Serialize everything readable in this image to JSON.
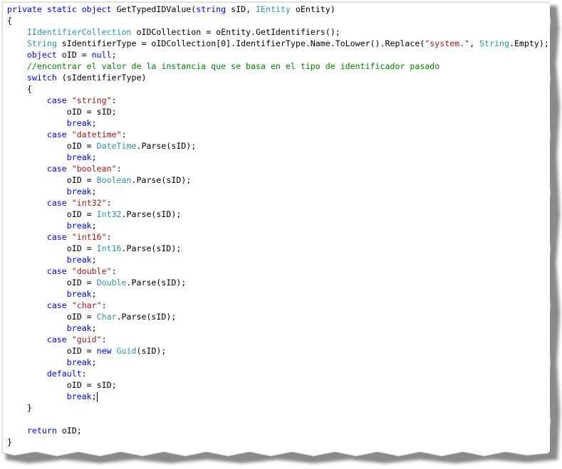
{
  "editor": {
    "lines": [
      [
        {
          "t": "private static object",
          "c": "keyword"
        },
        {
          "t": " GetTypedIDValue(",
          "c": "plain"
        },
        {
          "t": "string",
          "c": "keyword"
        },
        {
          "t": " sID, ",
          "c": "plain"
        },
        {
          "t": "IEntity",
          "c": "type"
        },
        {
          "t": " oEntity)",
          "c": "plain"
        }
      ],
      [
        {
          "t": "{",
          "c": "plain"
        }
      ],
      [
        {
          "t": "    ",
          "c": "plain"
        },
        {
          "t": "IIdentifierCollection",
          "c": "type"
        },
        {
          "t": " oIDCollection = oEntity.GetIdentifiers();",
          "c": "plain"
        }
      ],
      [
        {
          "t": "    ",
          "c": "plain"
        },
        {
          "t": "String",
          "c": "type"
        },
        {
          "t": " sIdentifierType = oIDCollection[0].IdentifierType.Name.ToLower().Replace(",
          "c": "plain"
        },
        {
          "t": "\"system.\"",
          "c": "string"
        },
        {
          "t": ", ",
          "c": "plain"
        },
        {
          "t": "String",
          "c": "type"
        },
        {
          "t": ".Empty);",
          "c": "plain"
        }
      ],
      [
        {
          "t": "    ",
          "c": "plain"
        },
        {
          "t": "object",
          "c": "keyword"
        },
        {
          "t": " oID = ",
          "c": "plain"
        },
        {
          "t": "null",
          "c": "keyword"
        },
        {
          "t": ";",
          "c": "plain"
        }
      ],
      [
        {
          "t": "    ",
          "c": "plain"
        },
        {
          "t": "//encontrar el valor de la instancia que se basa en el tipo de identificador pasado",
          "c": "comment"
        }
      ],
      [
        {
          "t": "    ",
          "c": "plain"
        },
        {
          "t": "switch",
          "c": "keyword"
        },
        {
          "t": " (sIdentifierType)",
          "c": "plain"
        }
      ],
      [
        {
          "t": "    {",
          "c": "plain"
        }
      ],
      [
        {
          "t": "        ",
          "c": "plain"
        },
        {
          "t": "case",
          "c": "keyword"
        },
        {
          "t": " ",
          "c": "plain"
        },
        {
          "t": "\"string\"",
          "c": "string"
        },
        {
          "t": ":",
          "c": "plain"
        }
      ],
      [
        {
          "t": "            oID = sID;",
          "c": "plain"
        }
      ],
      [
        {
          "t": "            ",
          "c": "plain"
        },
        {
          "t": "break",
          "c": "keyword"
        },
        {
          "t": ";",
          "c": "plain"
        }
      ],
      [
        {
          "t": "        ",
          "c": "plain"
        },
        {
          "t": "case",
          "c": "keyword"
        },
        {
          "t": " ",
          "c": "plain"
        },
        {
          "t": "\"datetime\"",
          "c": "string"
        },
        {
          "t": ":",
          "c": "plain"
        }
      ],
      [
        {
          "t": "            oID = ",
          "c": "plain"
        },
        {
          "t": "DateTime",
          "c": "type"
        },
        {
          "t": ".Parse(sID);",
          "c": "plain"
        }
      ],
      [
        {
          "t": "            ",
          "c": "plain"
        },
        {
          "t": "break",
          "c": "keyword"
        },
        {
          "t": ";",
          "c": "plain"
        }
      ],
      [
        {
          "t": "        ",
          "c": "plain"
        },
        {
          "t": "case",
          "c": "keyword"
        },
        {
          "t": " ",
          "c": "plain"
        },
        {
          "t": "\"boolean\"",
          "c": "string"
        },
        {
          "t": ":",
          "c": "plain"
        }
      ],
      [
        {
          "t": "            oID = ",
          "c": "plain"
        },
        {
          "t": "Boolean",
          "c": "type"
        },
        {
          "t": ".Parse(sID);",
          "c": "plain"
        }
      ],
      [
        {
          "t": "            ",
          "c": "plain"
        },
        {
          "t": "break",
          "c": "keyword"
        },
        {
          "t": ";",
          "c": "plain"
        }
      ],
      [
        {
          "t": "        ",
          "c": "plain"
        },
        {
          "t": "case",
          "c": "keyword"
        },
        {
          "t": " ",
          "c": "plain"
        },
        {
          "t": "\"int32\"",
          "c": "string"
        },
        {
          "t": ":",
          "c": "plain"
        }
      ],
      [
        {
          "t": "            oID = ",
          "c": "plain"
        },
        {
          "t": "Int32",
          "c": "type"
        },
        {
          "t": ".Parse(sID);",
          "c": "plain"
        }
      ],
      [
        {
          "t": "            ",
          "c": "plain"
        },
        {
          "t": "break",
          "c": "keyword"
        },
        {
          "t": ";",
          "c": "plain"
        }
      ],
      [
        {
          "t": "        ",
          "c": "plain"
        },
        {
          "t": "case",
          "c": "keyword"
        },
        {
          "t": " ",
          "c": "plain"
        },
        {
          "t": "\"int16\"",
          "c": "string"
        },
        {
          "t": ":",
          "c": "plain"
        }
      ],
      [
        {
          "t": "            oID = ",
          "c": "plain"
        },
        {
          "t": "Int16",
          "c": "type"
        },
        {
          "t": ".Parse(sID);",
          "c": "plain"
        }
      ],
      [
        {
          "t": "            ",
          "c": "plain"
        },
        {
          "t": "break",
          "c": "keyword"
        },
        {
          "t": ";",
          "c": "plain"
        }
      ],
      [
        {
          "t": "        ",
          "c": "plain"
        },
        {
          "t": "case",
          "c": "keyword"
        },
        {
          "t": " ",
          "c": "plain"
        },
        {
          "t": "\"double\"",
          "c": "string"
        },
        {
          "t": ":",
          "c": "plain"
        }
      ],
      [
        {
          "t": "            oID = ",
          "c": "plain"
        },
        {
          "t": "Double",
          "c": "type"
        },
        {
          "t": ".Parse(sID);",
          "c": "plain"
        }
      ],
      [
        {
          "t": "            ",
          "c": "plain"
        },
        {
          "t": "break",
          "c": "keyword"
        },
        {
          "t": ";",
          "c": "plain"
        }
      ],
      [
        {
          "t": "        ",
          "c": "plain"
        },
        {
          "t": "case",
          "c": "keyword"
        },
        {
          "t": " ",
          "c": "plain"
        },
        {
          "t": "\"char\"",
          "c": "string"
        },
        {
          "t": ":",
          "c": "plain"
        }
      ],
      [
        {
          "t": "            oID = ",
          "c": "plain"
        },
        {
          "t": "Char",
          "c": "type"
        },
        {
          "t": ".Parse(sID);",
          "c": "plain"
        }
      ],
      [
        {
          "t": "            ",
          "c": "plain"
        },
        {
          "t": "break",
          "c": "keyword"
        },
        {
          "t": ";",
          "c": "plain"
        }
      ],
      [
        {
          "t": "        ",
          "c": "plain"
        },
        {
          "t": "case",
          "c": "keyword"
        },
        {
          "t": " ",
          "c": "plain"
        },
        {
          "t": "\"guid\"",
          "c": "string"
        },
        {
          "t": ":",
          "c": "plain"
        }
      ],
      [
        {
          "t": "            oID = ",
          "c": "plain"
        },
        {
          "t": "new",
          "c": "keyword"
        },
        {
          "t": " ",
          "c": "plain"
        },
        {
          "t": "Guid",
          "c": "type"
        },
        {
          "t": "(sID);",
          "c": "plain"
        }
      ],
      [
        {
          "t": "            ",
          "c": "plain"
        },
        {
          "t": "break",
          "c": "keyword"
        },
        {
          "t": ";",
          "c": "plain"
        }
      ],
      [
        {
          "t": "        ",
          "c": "plain"
        },
        {
          "t": "default",
          "c": "keyword"
        },
        {
          "t": ":",
          "c": "plain"
        }
      ],
      [
        {
          "t": "            oID = sID;",
          "c": "plain"
        }
      ],
      [
        {
          "t": "            ",
          "c": "plain"
        },
        {
          "t": "break",
          "c": "keyword"
        },
        {
          "t": ";",
          "c": "plain"
        },
        {
          "t": "",
          "c": "caret"
        }
      ],
      [
        {
          "t": "    }",
          "c": "plain"
        }
      ],
      [
        {
          "t": "",
          "c": "plain"
        }
      ],
      [
        {
          "t": "    ",
          "c": "plain"
        },
        {
          "t": "return",
          "c": "keyword"
        },
        {
          "t": " oID;",
          "c": "plain"
        }
      ],
      [
        {
          "t": "}",
          "c": "plain"
        }
      ]
    ]
  },
  "colors": {
    "keyword": "#0000ff",
    "type": "#2b91af",
    "string": "#a31515",
    "comment": "#008000",
    "plain": "#000000",
    "background": "#ffffff"
  }
}
